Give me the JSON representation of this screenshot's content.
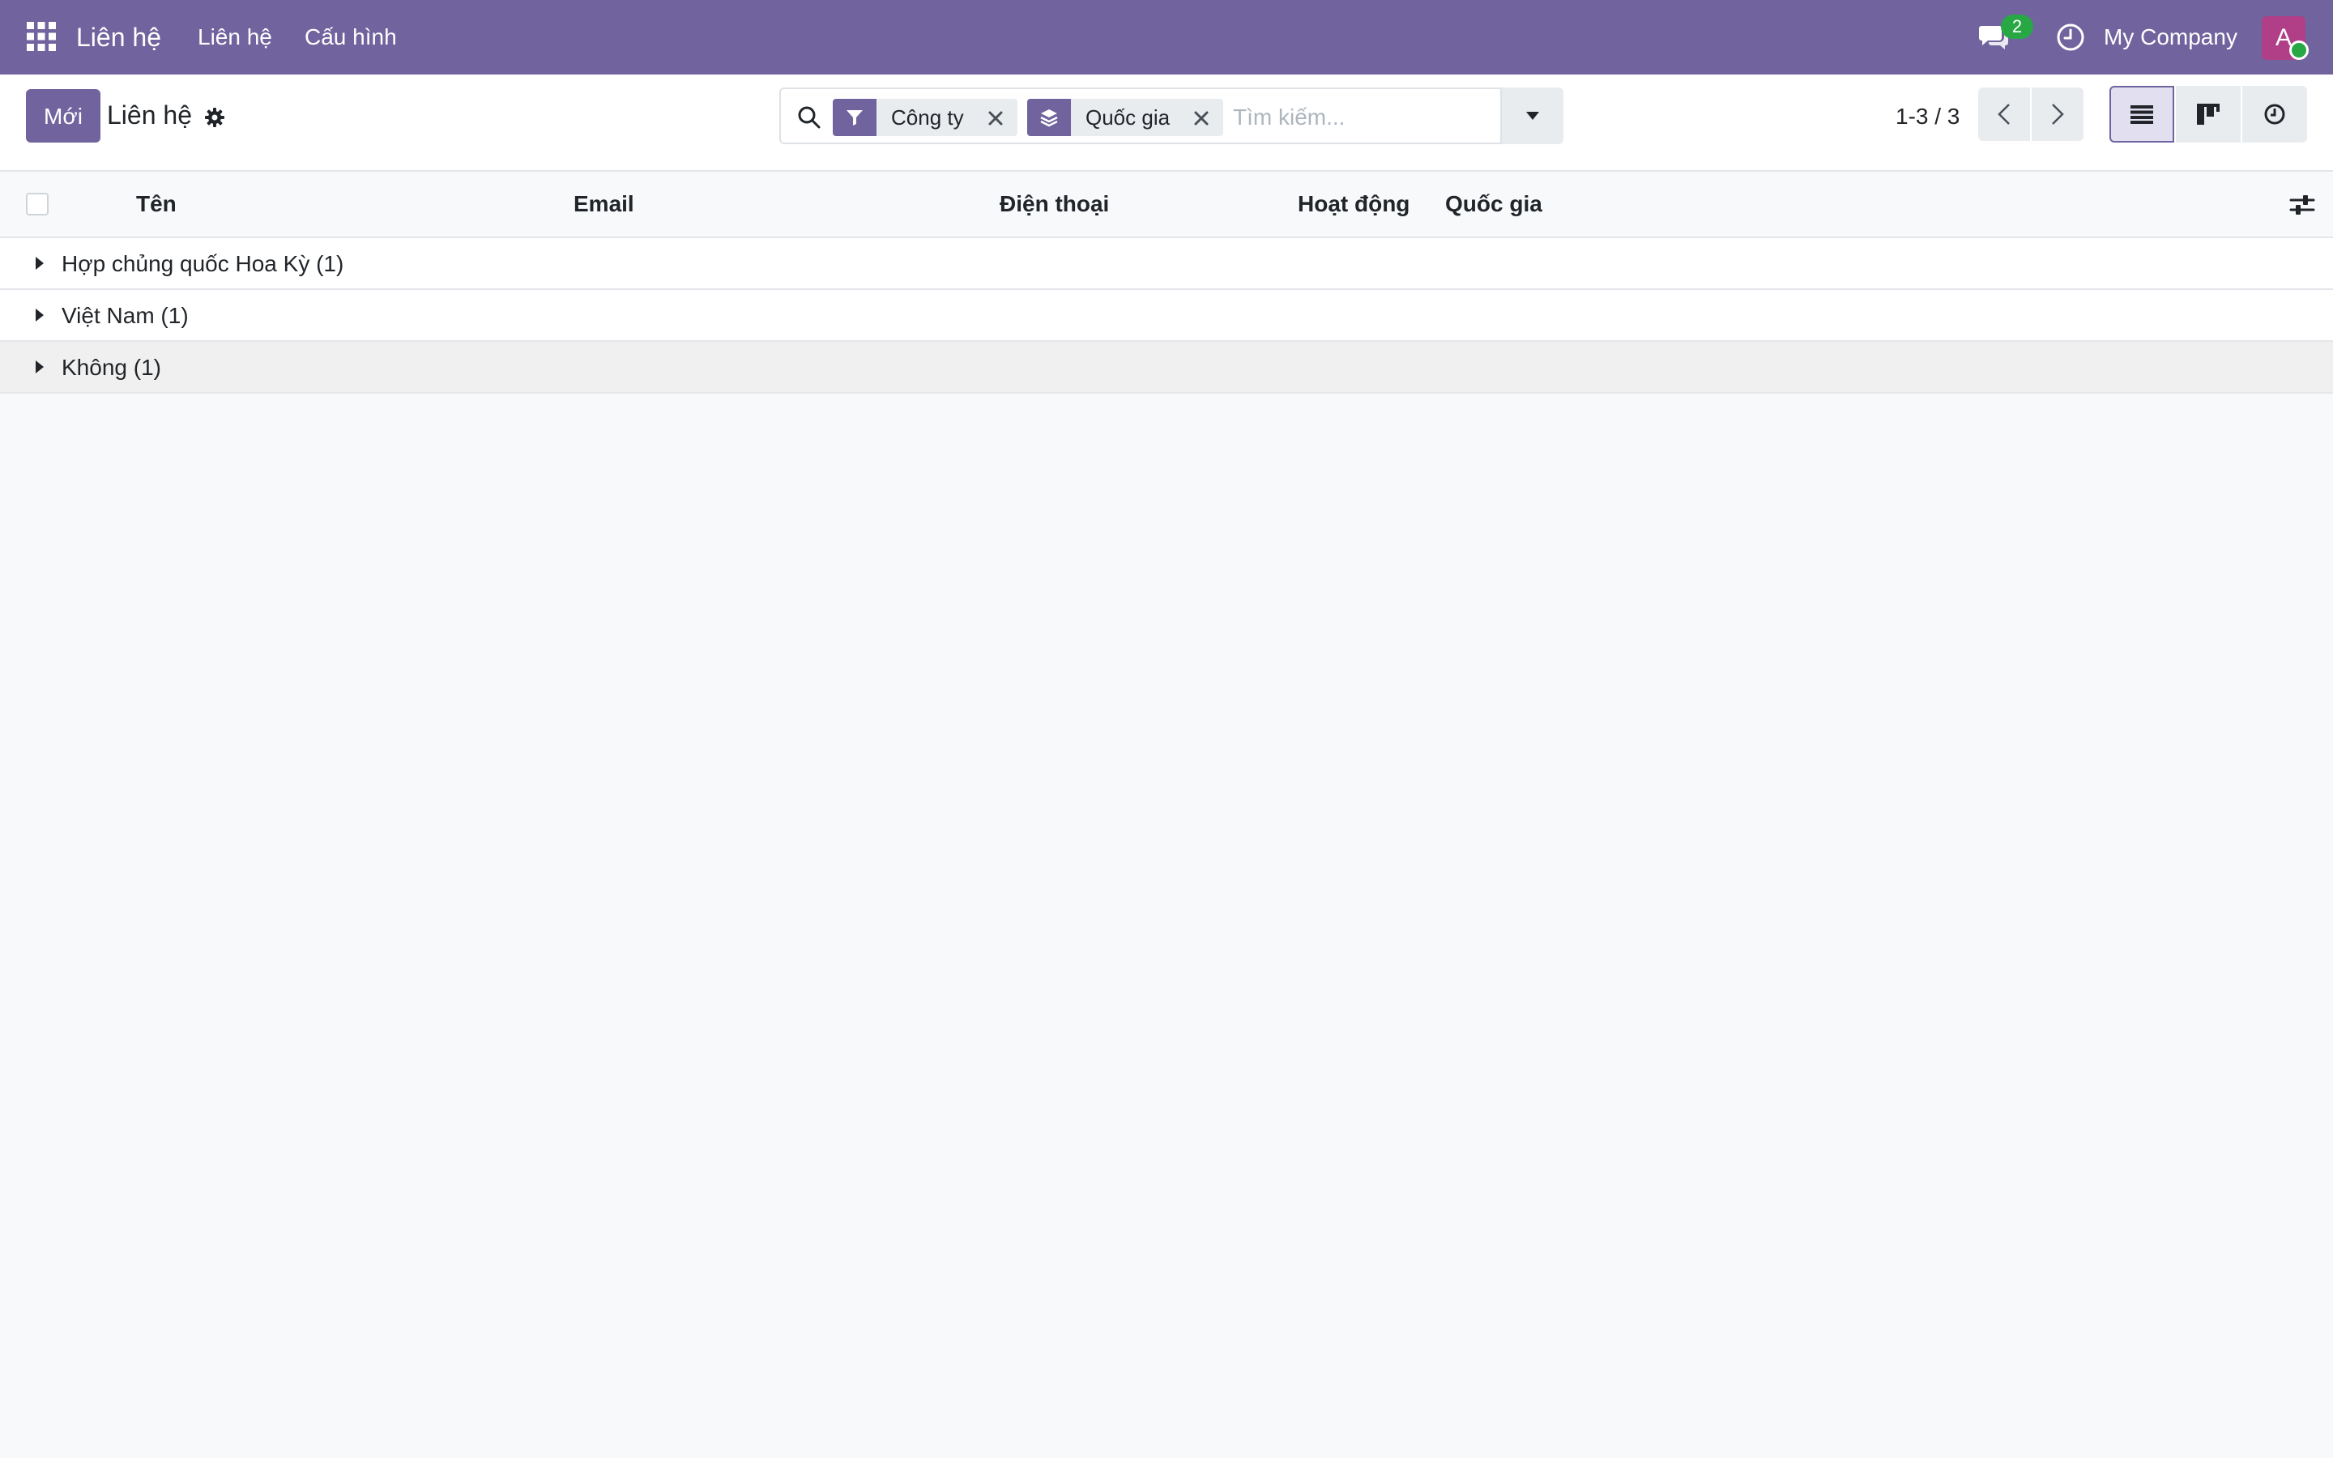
{
  "navbar": {
    "brand": "Liên hệ",
    "menu": [
      "Liên hệ",
      "Cấu hình"
    ],
    "chat_badge": "2",
    "company": "My Company",
    "avatar_initial": "A",
    "icons": [
      "apps-grid-icon",
      "chat-icon",
      "clock-icon"
    ],
    "background_color": "#71639e"
  },
  "control_panel": {
    "new_button": "Mới",
    "title": "Liên hệ",
    "search": {
      "facets": [
        {
          "type": "filter",
          "icon": "filter-icon",
          "value": "Công ty"
        },
        {
          "type": "groupby",
          "icon": "layers-icon",
          "value": "Quốc gia"
        }
      ],
      "placeholder": "Tìm kiếm..."
    },
    "pager": "1-3 / 3",
    "views": [
      "list-view-icon",
      "kanban-view-icon",
      "activity-view-icon"
    ]
  },
  "table": {
    "columns": [
      "Tên",
      "Email",
      "Điện thoại",
      "Hoạt động",
      "Quốc gia"
    ],
    "groups": [
      {
        "label": "Hợp chủng quốc Hoa Kỳ (1)"
      },
      {
        "label": "Việt Nam (1)"
      },
      {
        "label": "Không (1)"
      }
    ]
  }
}
